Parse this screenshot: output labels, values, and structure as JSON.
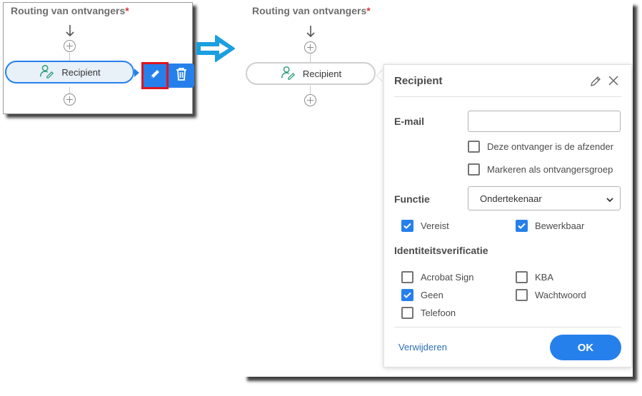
{
  "left_panel": {
    "title": "Routing van ontvangers",
    "required_mark": "*",
    "recipient_label": "Recipient"
  },
  "right_panel": {
    "title": "Routing van ontvangers",
    "required_mark": "*",
    "recipient_label": "Recipient"
  },
  "popover": {
    "header": "Recipient",
    "email_label": "E-mail",
    "email_value": "",
    "sender_checkbox": {
      "label": "Deze ontvanger is de afzender",
      "checked": false
    },
    "group_checkbox": {
      "label": "Markeren als ontvangersgroep",
      "checked": false
    },
    "role_label": "Functie",
    "role_value": "Ondertekenaar",
    "required_checkbox": {
      "label": "Vereist",
      "checked": true
    },
    "editable_checkbox": {
      "label": "Bewerkbaar",
      "checked": true
    },
    "identity_label": "Identiteitsverificatie",
    "identity_options": [
      {
        "label": "Acrobat Sign",
        "checked": false
      },
      {
        "label": "KBA",
        "checked": false
      },
      {
        "label": "Geen",
        "checked": true
      },
      {
        "label": "Wachtwoord",
        "checked": false
      },
      {
        "label": "Telefoon",
        "checked": false
      }
    ],
    "delete_link": "Verwijderen",
    "ok_button": "OK"
  },
  "colors": {
    "accent": "#2680eb",
    "highlight_box": "#e0141e",
    "required": "#d7373f",
    "icon_green": "#2d9d78",
    "arrow_blue": "#1a9fe0"
  },
  "icons": [
    "arrow-down-icon",
    "plus-circle-icon",
    "recipient-signer-icon",
    "pencil-icon",
    "trash-icon",
    "close-icon",
    "chevron-down-icon",
    "checkmark-icon",
    "right-arrow-icon"
  ]
}
